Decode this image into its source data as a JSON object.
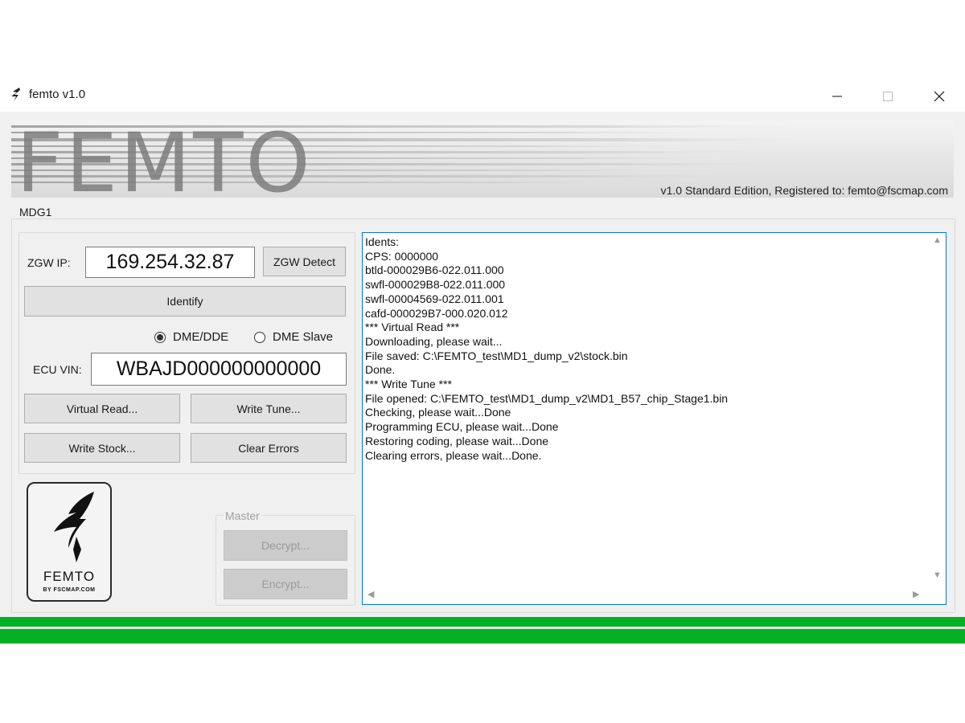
{
  "window": {
    "title": "femto v1.0",
    "controls": {
      "minimize": "minimize",
      "maximize": "maximize",
      "close": "close"
    }
  },
  "banner": {
    "logo_text": "FEMTO",
    "info": "v1.0 Standard Edition, Registered to: femto@fscmap.com"
  },
  "mdg1": {
    "group_label": "MDG1",
    "zgw_ip_label": "ZGW IP:",
    "zgw_ip_value": "169.254.32.87",
    "zgw_detect_label": "ZGW Detect",
    "identify_label": "Identify",
    "radio_dme_dde": "DME/DDE",
    "radio_dme_slave": "DME Slave",
    "radio_selected": "DME/DDE",
    "ecu_vin_label": "ECU VIN:",
    "ecu_vin_value": "WBAJD000000000000",
    "virtual_read_label": "Virtual Read...",
    "write_tune_label": "Write Tune...",
    "write_stock_label": "Write Stock...",
    "clear_errors_label": "Clear Errors"
  },
  "logo": {
    "word": "FEMTO",
    "sub": "BY FSCMAP.COM"
  },
  "master": {
    "group_label": "Master",
    "decrypt_label": "Decrypt...",
    "encrypt_label": "Encrypt...",
    "enabled": false
  },
  "log": {
    "lines": [
      "Idents:",
      "CPS: 0000000",
      "btld-000029B6-022.011.000",
      "swfl-000029B8-022.011.000",
      "swfl-00004569-022.011.001",
      "cafd-000029B7-000.020.012",
      "*** Virtual Read ***",
      "Downloading, please wait...",
      "File saved: C:\\FEMTO_test\\MD1_dump_v2\\stock.bin",
      "Done.",
      "*** Write Tune ***",
      "File opened: C:\\FEMTO_test\\MD1_dump_v2\\MD1_B57_chip_Stage1.bin",
      "Checking, please wait...Done",
      "Programming ECU, please wait...Done",
      "Restoring coding, please wait...Done",
      "Clearing errors, please wait...Done."
    ]
  },
  "progress": {
    "value_percent": 100,
    "color": "#06b025"
  },
  "colors": {
    "accent": "#0078d7",
    "progress": "#06b025",
    "window_bg": "#f0f0f0"
  }
}
